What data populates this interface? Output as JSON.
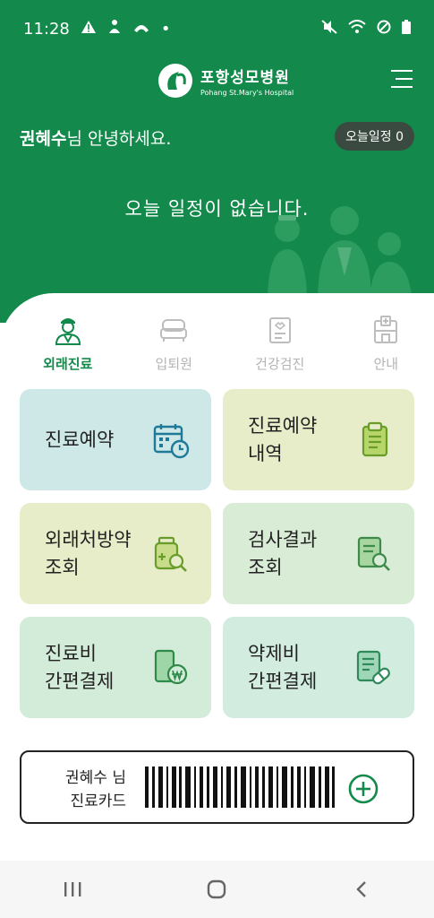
{
  "status_bar": {
    "time": "11:28",
    "dot": "•"
  },
  "header": {
    "logo_ko": "포항성모병원",
    "logo_en": "Pohang St.Mary's Hospital",
    "user_name": "권혜수",
    "greeting_suffix": "님 안녕하세요.",
    "today_badge": "오늘일정 0",
    "no_schedule": "오늘 일정이 없습니다."
  },
  "tabs": [
    {
      "label": "외래진료",
      "icon": "doctor-icon",
      "active": true
    },
    {
      "label": "입퇴원",
      "icon": "bed-icon",
      "active": false
    },
    {
      "label": "건강검진",
      "icon": "clipboard-icon",
      "active": false
    },
    {
      "label": "안내",
      "icon": "hospital-icon",
      "active": false
    }
  ],
  "tiles": [
    {
      "line1": "진료예약",
      "line2": "",
      "icon": "calendar-clock-icon",
      "bg": "#cde8e6"
    },
    {
      "line1": "진료예약",
      "line2": "내역",
      "icon": "clipboard-list-icon",
      "bg": "#e7edc9"
    },
    {
      "line1": "외래처방약",
      "line2": "조회",
      "icon": "medicine-search-icon",
      "bg": "#e7edc9"
    },
    {
      "line1": "검사결과",
      "line2": "조회",
      "icon": "document-search-icon",
      "bg": "#d9ecd6"
    },
    {
      "line1": "진료비",
      "line2": "간편결제",
      "icon": "phone-payment-icon",
      "bg": "#d3ecd9"
    },
    {
      "line1": "약제비",
      "line2": "간편결제",
      "icon": "pill-document-icon",
      "bg": "#d3ece0"
    }
  ],
  "card": {
    "name_line": "권혜수 님",
    "label": "진료카드"
  },
  "colors": {
    "brand": "#138a4b",
    "badge": "#3a4a40"
  }
}
